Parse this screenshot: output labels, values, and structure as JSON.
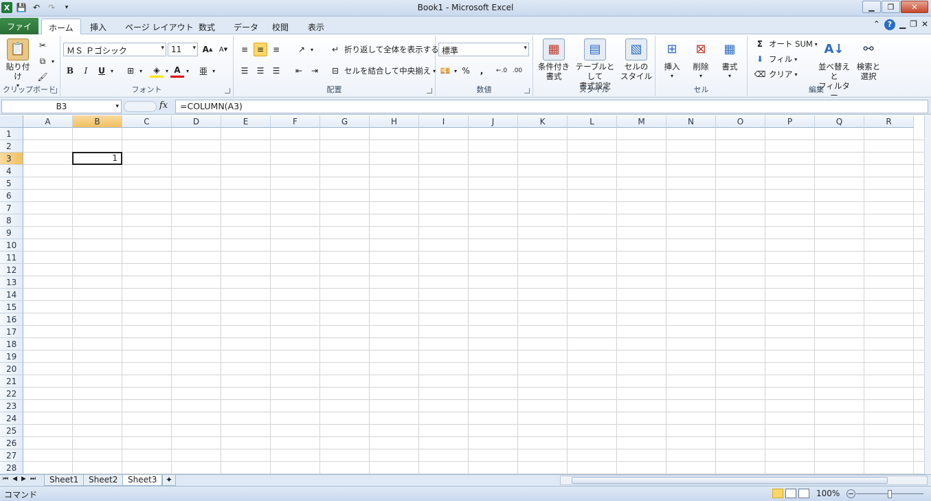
{
  "window": {
    "title": "Book1  -  Microsoft Excel"
  },
  "tabs": [
    {
      "label": "ファイル"
    },
    {
      "label": "ホーム"
    },
    {
      "label": "挿入"
    },
    {
      "label": "ページ レイアウト"
    },
    {
      "label": "数式"
    },
    {
      "label": "データ"
    },
    {
      "label": "校閲"
    },
    {
      "label": "表示"
    }
  ],
  "active_tab": "ホーム",
  "ribbon": {
    "clipboard": {
      "group": "クリップボード",
      "paste": "貼り付け"
    },
    "font": {
      "group": "フォント",
      "name": "ＭＳ Ｐゴシック",
      "size": "11",
      "bold": "B",
      "italic": "I",
      "underline": "U"
    },
    "alignment": {
      "group": "配置",
      "wrap": "折り返して全体を表示する",
      "merge": "セルを結合して中央揃え"
    },
    "number": {
      "group": "数値",
      "format": "標準",
      "percent": "%",
      "comma": ","
    },
    "styles": {
      "group": "スタイル",
      "conditional": "条件付き\n書式",
      "table": "テーブルとして\n書式設定",
      "cellstyle": "セルの\nスタイル"
    },
    "cells": {
      "group": "セル",
      "insert": "挿入",
      "delete": "削除",
      "format": "書式"
    },
    "editing": {
      "group": "編集",
      "autosum": "オート SUM",
      "fill": "フィル",
      "clear": "クリア",
      "sort": "並べ替えと\nフィルター",
      "find": "検索と\n選択"
    }
  },
  "formula_bar": {
    "name_box": "B3",
    "fx": "fx",
    "formula": "=COLUMN(A3)"
  },
  "columns": [
    "A",
    "B",
    "C",
    "D",
    "E",
    "F",
    "G",
    "H",
    "I",
    "J",
    "K",
    "L",
    "M",
    "N",
    "O",
    "P",
    "Q",
    "R"
  ],
  "rows": [
    "1",
    "2",
    "3",
    "4",
    "5",
    "6",
    "7",
    "8",
    "9",
    "10",
    "11",
    "12",
    "13",
    "14",
    "15",
    "16",
    "17",
    "18",
    "19",
    "20",
    "21",
    "22",
    "23",
    "24",
    "25",
    "26",
    "27",
    "28"
  ],
  "cells": [
    {
      "ref": "B3",
      "value": "1"
    }
  ],
  "sheets": [
    {
      "label": "Sheet1"
    },
    {
      "label": "Sheet2"
    },
    {
      "label": "Sheet3"
    }
  ],
  "active_sheet": "Sheet3",
  "status": {
    "mode": "コマンド",
    "zoom": "100%"
  }
}
